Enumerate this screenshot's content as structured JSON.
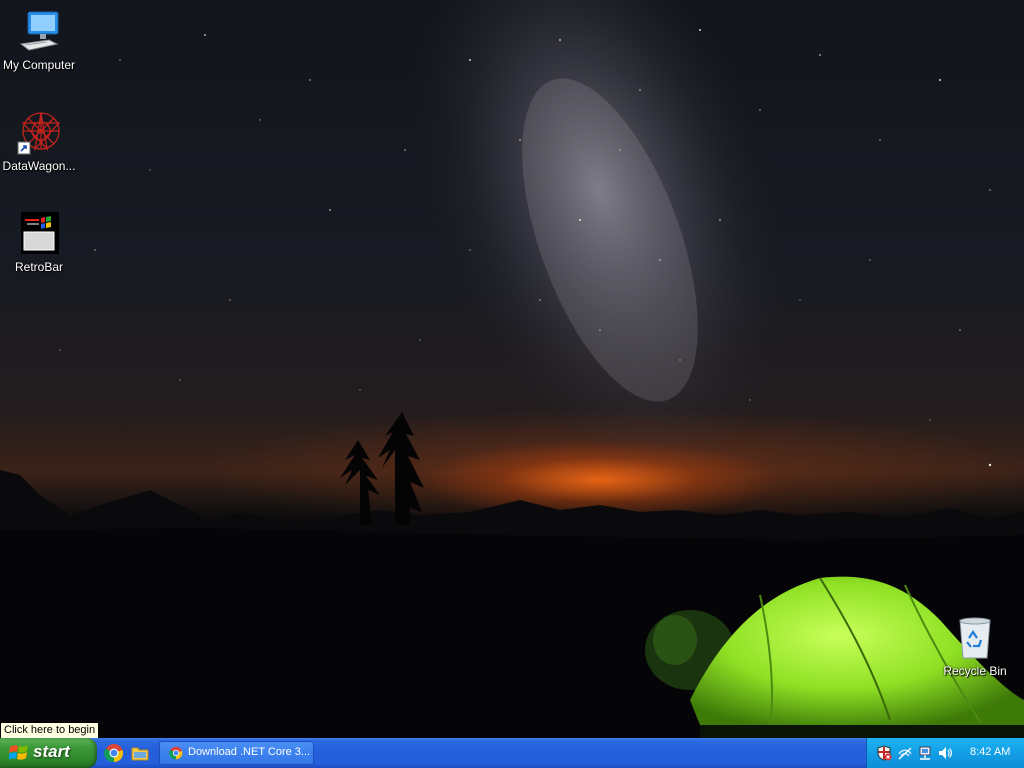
{
  "desktop": {
    "icons": [
      {
        "label": "My Computer",
        "icon": "computer-icon"
      },
      {
        "label": "DataWagon...",
        "icon": "datawagon-icon"
      },
      {
        "label": "RetroBar",
        "icon": "retrobar-icon"
      },
      {
        "label": "Recycle Bin",
        "icon": "recycle-bin-icon"
      }
    ]
  },
  "tooltip": {
    "text": "Click here to begin"
  },
  "taskbar": {
    "start_label": "start",
    "quicklaunch": [
      {
        "icon": "chrome-icon"
      },
      {
        "icon": "file-explorer-icon"
      }
    ],
    "task_buttons": [
      {
        "label": "Download .NET Core 3...",
        "icon": "chrome-icon"
      }
    ],
    "tray": {
      "icons": [
        "security-shield-icon",
        "network-disconnected-icon",
        "network-icon",
        "volume-icon"
      ],
      "clock": "8:42 AM"
    }
  },
  "colors": {
    "taskbar_blue": "#245edb",
    "start_green": "#3c9a3a",
    "tray_blue": "#129ee6",
    "tooltip_bg": "#ffffe1"
  }
}
